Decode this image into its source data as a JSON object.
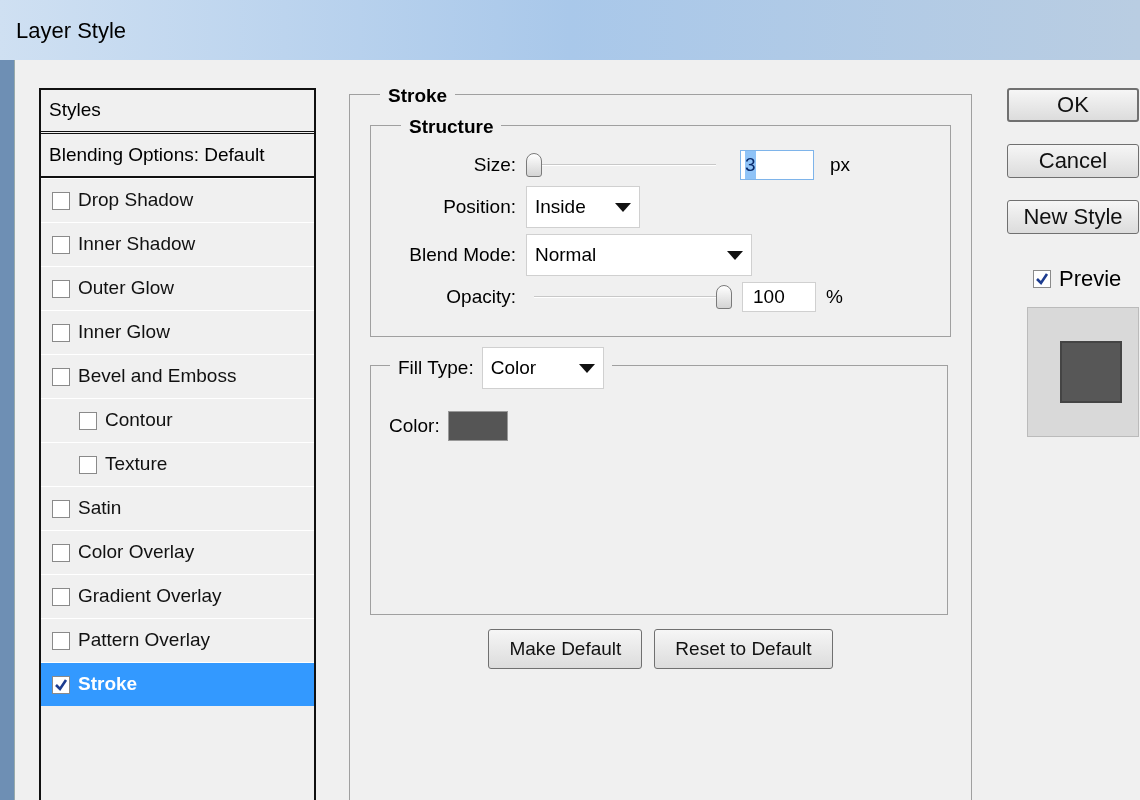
{
  "window": {
    "title": "Layer Style"
  },
  "sidebar": {
    "header": "Styles",
    "blending": "Blending Options: Default",
    "items": [
      {
        "label": "Drop Shadow",
        "checked": false,
        "selected": false
      },
      {
        "label": "Inner Shadow",
        "checked": false,
        "selected": false
      },
      {
        "label": "Outer Glow",
        "checked": false,
        "selected": false
      },
      {
        "label": "Inner Glow",
        "checked": false,
        "selected": false
      },
      {
        "label": "Bevel and Emboss",
        "checked": false,
        "selected": false,
        "children": [
          {
            "label": "Contour",
            "checked": false,
            "selected": false
          },
          {
            "label": "Texture",
            "checked": false,
            "selected": false
          }
        ]
      },
      {
        "label": "Satin",
        "checked": false,
        "selected": false
      },
      {
        "label": "Color Overlay",
        "checked": false,
        "selected": false
      },
      {
        "label": "Gradient Overlay",
        "checked": false,
        "selected": false
      },
      {
        "label": "Pattern Overlay",
        "checked": false,
        "selected": false
      },
      {
        "label": "Stroke",
        "checked": true,
        "selected": true
      }
    ]
  },
  "panel": {
    "title": "Stroke",
    "structure": {
      "title": "Structure",
      "size": {
        "label": "Size:",
        "level": 0.0,
        "value": "3",
        "unit": "px"
      },
      "position": {
        "label": "Position:",
        "value": "Inside"
      },
      "blend_mode": {
        "label": "Blend Mode:",
        "value": "Normal"
      },
      "opacity": {
        "label": "Opacity:",
        "level": 1.0,
        "value": "100",
        "unit": "%"
      }
    },
    "fill_type": {
      "label": "Fill Type:",
      "value": "Color",
      "color_label": "Color:",
      "color": "#555555"
    },
    "buttons": [
      "Make Default",
      "Reset to Default"
    ]
  },
  "actions": [
    {
      "label": "OK",
      "default": true
    },
    {
      "label": "Cancel",
      "default": false
    },
    {
      "label": "New Style"
    }
  ],
  "preview": {
    "label": "Previe",
    "checked": true
  }
}
